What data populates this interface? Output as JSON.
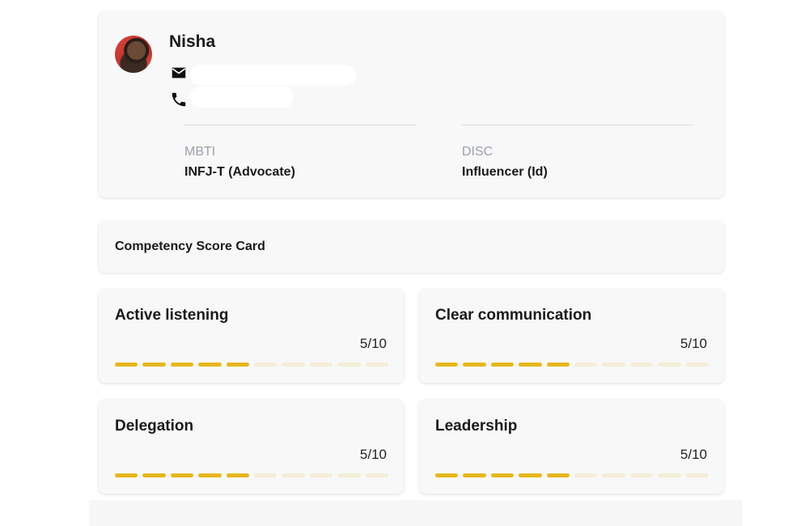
{
  "profile": {
    "name": "Nisha",
    "email_icon": "mail-icon",
    "phone_icon": "phone-icon",
    "mbti": {
      "label": "MBTI",
      "value": "INFJ-T (Advocate)"
    },
    "disc": {
      "label": "DISC",
      "value": "Influencer (Id)"
    }
  },
  "scorecard": {
    "title": "Competency Score Card",
    "max_score": 10,
    "accent_color": "#e6b71e",
    "items": [
      {
        "title": "Active listening",
        "score": 5,
        "score_text": "5/10"
      },
      {
        "title": "Clear communication",
        "score": 5,
        "score_text": "5/10"
      },
      {
        "title": "Delegation",
        "score": 5,
        "score_text": "5/10"
      },
      {
        "title": "Leadership",
        "score": 5,
        "score_text": "5/10"
      }
    ]
  }
}
